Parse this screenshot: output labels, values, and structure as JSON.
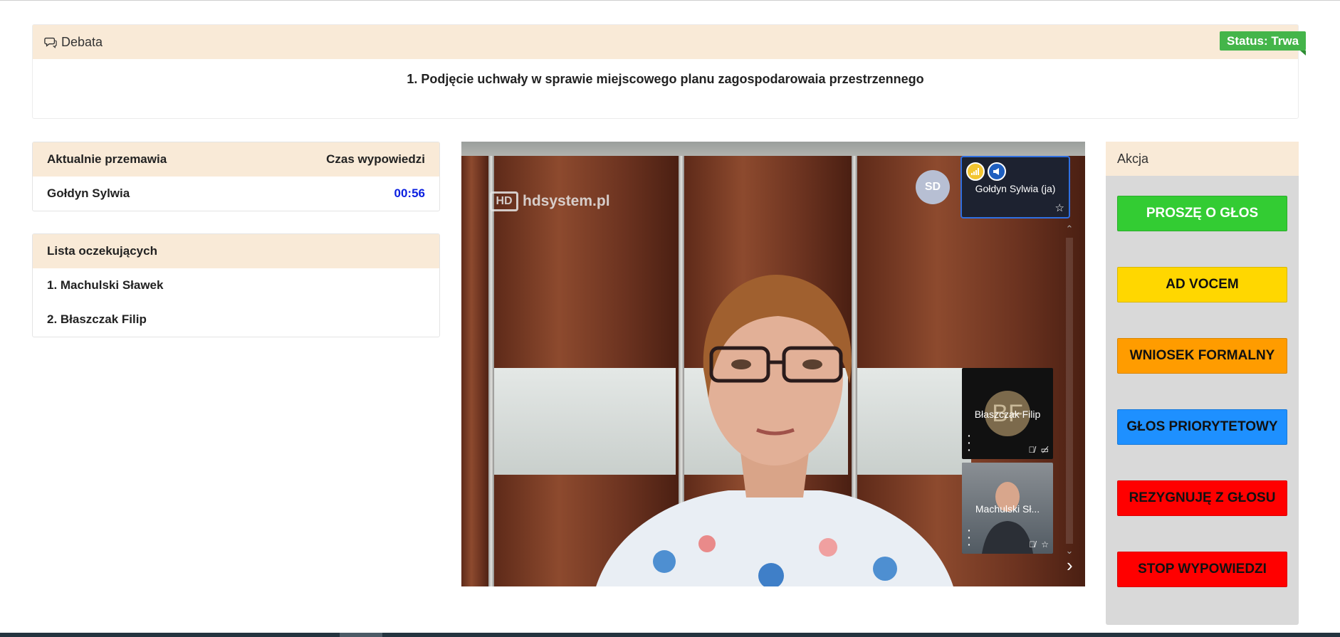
{
  "debate": {
    "header": "Debata",
    "status": "Status: Trwa",
    "title": "1. Podjęcie uchwały w sprawie miejscowego planu zagospodarowaia przestrzennego"
  },
  "current_speaker": {
    "col_speaker": "Aktualnie przemawia",
    "col_time": "Czas wypowiedzi",
    "name": "Gołdyn Sylwia",
    "time": "00:56"
  },
  "queue": {
    "title": "Lista oczekujących",
    "items": [
      "1. Machulski Sławek",
      "2. Błaszczak Filip"
    ]
  },
  "video": {
    "watermark": "hdsystem.pl",
    "watermark_logo": "HD",
    "self_avatar_initials": "SD",
    "self_tile_name": "Gołdyn Sylwia (ja)",
    "participants": [
      {
        "name": "Błaszczak Filip",
        "initials": "BF"
      },
      {
        "name": "Machulski Sł..."
      }
    ]
  },
  "actions": {
    "title": "Akcja",
    "buttons": [
      {
        "label": "PROSZĘ O GŁOS",
        "color": "#33cc33",
        "text_color": "#ffffff"
      },
      {
        "label": "AD VOCEM",
        "color": "#ffd700",
        "text_color": "#111111"
      },
      {
        "label": "WNIOSEK FORMALNY",
        "color": "#ff9c00",
        "text_color": "#111111"
      },
      {
        "label": "GŁOS PRIORYTETOWY",
        "color": "#1e90ff",
        "text_color": "#111111"
      },
      {
        "label": "REZYGNUJĘ Z GŁOSU",
        "color": "#ff0000",
        "text_color": "#111111"
      },
      {
        "label": "STOP WYPOWIEDZI",
        "color": "#ff0000",
        "text_color": "#111111"
      }
    ]
  },
  "colors": {
    "header_bg": "#f9ead7",
    "status_green": "#44b54a",
    "timer_blue": "#0a1fe0",
    "active_tile_border": "#2f6fe0"
  }
}
